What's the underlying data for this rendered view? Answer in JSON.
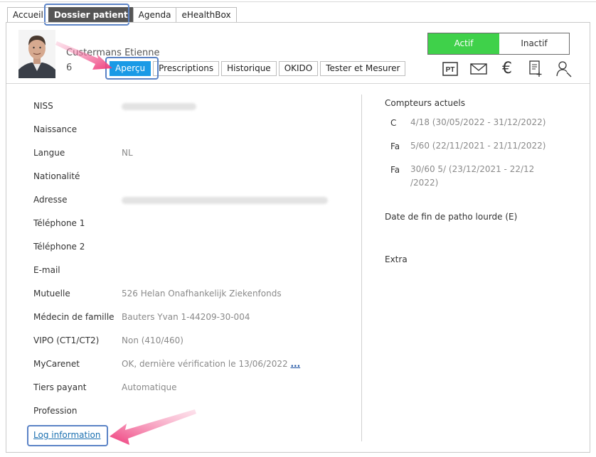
{
  "tabs": [
    "Accueil",
    "Dossier patient",
    "Agenda",
    "eHealthBox"
  ],
  "patient": {
    "name": "Custermans Etienne",
    "number": "6"
  },
  "subtabs": [
    "Aperçu",
    "Prescriptions",
    "Historique",
    "OKIDO",
    "Tester et Mesurer"
  ],
  "status": {
    "active": "Actif",
    "inactive": "Inactif"
  },
  "icon_bar": {
    "pt_label": "PT",
    "euro_symbol": "€"
  },
  "icons": [
    "pt-icon",
    "mail-icon",
    "euro-icon",
    "document-add-icon",
    "user-search-icon"
  ],
  "fields": [
    {
      "label": "NISS",
      "value": ""
    },
    {
      "label": "Naissance",
      "value": ""
    },
    {
      "label": "Langue",
      "value": "NL"
    },
    {
      "label": "Nationalité",
      "value": ""
    },
    {
      "label": "Adresse",
      "value": ""
    },
    {
      "label": "Téléphone 1",
      "value": ""
    },
    {
      "label": "Téléphone 2",
      "value": ""
    },
    {
      "label": "E-mail",
      "value": ""
    },
    {
      "label": "Mutuelle",
      "value": "526 Helan Onafhankelijk Ziekenfonds"
    },
    {
      "label": "Médecin de famille",
      "value": "Bauters Yvan 1-44209-30-004"
    },
    {
      "label": "VIPO (CT1/CT2)",
      "value": "Non (410/460)"
    },
    {
      "label": "MyCarenet",
      "value": "OK, dernière vérification le 13/06/2022",
      "more": "..."
    },
    {
      "label": "Tiers payant",
      "value": "Automatique"
    },
    {
      "label": "Profession",
      "value": ""
    }
  ],
  "log_link": "Log information",
  "counters": {
    "title": "Compteurs actuels",
    "items": [
      {
        "code": "C",
        "line1": "4/18 (30/05/2022 - 31/12/2022)",
        "line2": ""
      },
      {
        "code": "Fa",
        "line1": "5/60 (22/11/2021 - 21/11/2022)",
        "line2": ""
      },
      {
        "code": "Fa",
        "line1": "30/60 5/ (23/12/2021 - 22/12",
        "line2": "/2022)"
      }
    ]
  },
  "patho_label": "Date de fin de patho lourde (E)",
  "extra_label": "Extra"
}
